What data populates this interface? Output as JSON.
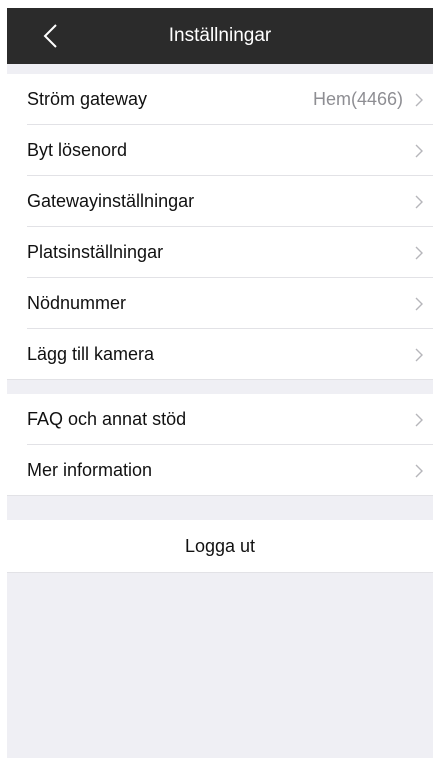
{
  "header": {
    "title": "Inställningar",
    "back_icon": "chevron-left-icon"
  },
  "groups": [
    {
      "items": [
        {
          "label": "Ström gateway",
          "value": "Hem(4466)"
        },
        {
          "label": "Byt lösenord",
          "value": ""
        },
        {
          "label": "Gatewayinställningar",
          "value": ""
        },
        {
          "label": "Platsinställningar",
          "value": ""
        },
        {
          "label": "Nödnummer",
          "value": ""
        },
        {
          "label": "Lägg till kamera",
          "value": ""
        }
      ]
    },
    {
      "items": [
        {
          "label": "FAQ och annat stöd",
          "value": ""
        },
        {
          "label": "Mer information",
          "value": ""
        }
      ]
    }
  ],
  "logout_label": "Logga ut",
  "colors": {
    "navbar_bg": "#2b2b2b",
    "page_bg": "#efeff4",
    "value_text": "#8e8e93",
    "chevron": "#b6b6bb"
  }
}
